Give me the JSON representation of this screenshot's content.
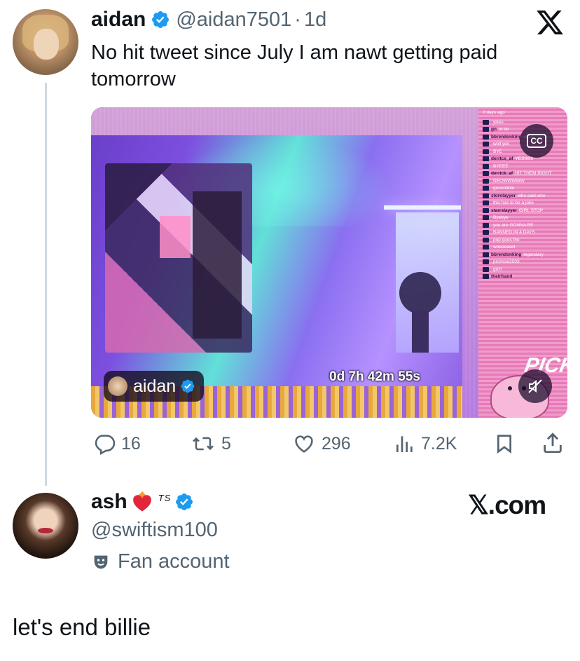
{
  "tweet": {
    "name": "aidan",
    "handle": "@aidan7501",
    "separator": "·",
    "time": "1d",
    "text": "No hit tweet since July I am nawt getting paid tomorrow",
    "x_logo": "𝕏",
    "media": {
      "streamer_tag": "aidan",
      "timer": "0d 7h 42m 55s",
      "cc_label": "CC",
      "chat_header": "2 days ago",
      "brand_text": "PICK",
      "chat": [
        {
          "user": "",
          "msg": "yikes"
        },
        {
          "user": "gn",
          "msg": "to be"
        },
        {
          "user": "bbrendonking",
          "msg": "ately"
        },
        {
          "user": "",
          "msg": "well yes"
        },
        {
          "user": "",
          "msg": "BYE"
        },
        {
          "user": "derrtcx_af",
          "msg": "YESSSS"
        },
        {
          "user": "",
          "msg": "BYEEE"
        },
        {
          "user": "derrick_af",
          "msg": "HIT THEM RIGHT"
        },
        {
          "user": "",
          "msg": "NEOWWWWW"
        },
        {
          "user": "",
          "msg": "goooodnie"
        },
        {
          "user": "stornlayyer",
          "msg": "who said who"
        },
        {
          "user": "",
          "msg": "this has to be a joke"
        },
        {
          "user": "starrslayyer",
          "msg": "GIRL STOP"
        },
        {
          "user": "",
          "msg": "Byebye"
        },
        {
          "user": "",
          "msg": "you are GONNA BE"
        },
        {
          "user": "",
          "msg": "BANNED IN 4 DAYS"
        },
        {
          "user": "",
          "msg": "pop goes the"
        },
        {
          "user": "",
          "msg": "weeeeasel"
        },
        {
          "user": "bbrendonking",
          "msg": "legendary"
        },
        {
          "user": "",
          "msg": "promise2503"
        },
        {
          "user": "",
          "msg": "gn!!!"
        },
        {
          "user": "theirfrand",
          "msg": ""
        }
      ]
    },
    "stats": {
      "replies": "16",
      "retweets": "5",
      "likes": "296",
      "views": "7.2K"
    }
  },
  "reply": {
    "name": "ash",
    "badge_text": "TS",
    "handle": "@swiftism100",
    "label": "Fan account",
    "watermark": "𝕏.com"
  },
  "caption": "let's end billie",
  "colors": {
    "verified": "#1d9bf0",
    "secondary_text": "#536471",
    "thread_line": "#cfd9de"
  }
}
